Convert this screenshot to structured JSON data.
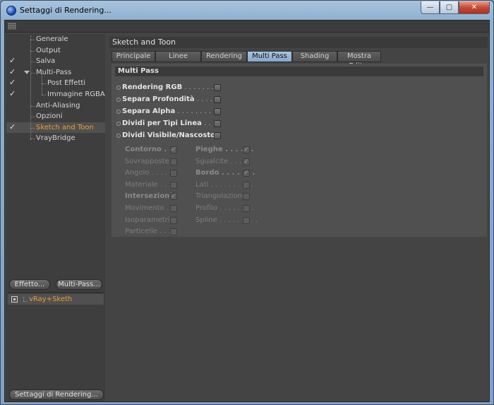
{
  "window": {
    "title": "Settaggi di Rendering..."
  },
  "caption": {
    "minimize": "—",
    "maximize": "▢",
    "close": "✕"
  },
  "tree": [
    {
      "label": "Generale",
      "checked": false
    },
    {
      "label": "Output",
      "checked": false
    },
    {
      "label": "Salva",
      "checked": true
    },
    {
      "label": "Multi-Pass",
      "checked": true
    },
    {
      "label": "Post Effetti",
      "checked": true
    },
    {
      "label": "Immagine RGBA",
      "checked": true
    },
    {
      "label": "Anti-Aliasing",
      "checked": false
    },
    {
      "label": "Opzioni",
      "checked": false
    },
    {
      "label": "Sketch and Toon",
      "checked": true
    },
    {
      "label": "VrayBridge",
      "checked": false
    }
  ],
  "check_glyph": "✓",
  "buttons": {
    "effetto": "Effetto...",
    "multipass": "Multi-Pass...",
    "settaggi": "Settaggi di Rendering..."
  },
  "effects": [
    {
      "label": "vRay+Sketh"
    }
  ],
  "panel": {
    "title": "Sketch and Toon",
    "tabs": [
      "Principale",
      "Linee",
      "Rendering",
      "Multi Pass",
      "Shading",
      "Mostra Editor"
    ],
    "active_tab": "Multi Pass",
    "section": "Multi Pass",
    "options": [
      {
        "label": "Rendering RGB",
        "leader": " . . . . . . . ."
      },
      {
        "label": "Separa Profondità",
        "leader": " . . . . . ."
      },
      {
        "label": "Separa Alpha",
        "leader": " . . . . . . . . . ."
      },
      {
        "label": "Dividi per Tipi Linea",
        "leader": " . . . ."
      },
      {
        "label": "Dividi Visibile/Nascosto",
        "leader": ""
      }
    ],
    "left_col": [
      {
        "label": "Contorno",
        "leader": " . . ",
        "bold": true,
        "checked": true
      },
      {
        "label": "Sovrapposte",
        "leader": " ",
        "bold": false,
        "checked": false
      },
      {
        "label": "Angolo",
        "leader": " . . . . . ",
        "bold": false,
        "checked": false
      },
      {
        "label": "Materiale",
        "leader": " . . . . ",
        "bold": false,
        "checked": false
      },
      {
        "label": "Intersezioni",
        "leader": " ",
        "bold": true,
        "checked": true
      },
      {
        "label": "Movimento",
        "leader": " . . ",
        "bold": false,
        "checked": false
      },
      {
        "label": "Isoparametri",
        "leader": " ",
        "bold": false,
        "checked": false
      },
      {
        "label": "Particelle",
        "leader": " . . . ",
        "bold": false,
        "checked": false
      }
    ],
    "right_col": [
      {
        "label": "Pieghe",
        "leader": " . . . . . .",
        "bold": true,
        "checked": true
      },
      {
        "label": "Sgualcite",
        "leader": " . . . . ",
        "bold": false,
        "checked": true
      },
      {
        "label": "Bordo",
        "leader": " . . . . . . .",
        "bold": true,
        "checked": true
      },
      {
        "label": "Lati",
        "leader": " . . . . . . . . . .",
        "bold": false,
        "checked": false
      },
      {
        "label": "Triangolazione",
        "leader": "",
        "bold": false,
        "checked": false
      },
      {
        "label": "Profilo",
        "leader": " . . . . . . . .",
        "bold": false,
        "checked": false
      },
      {
        "label": "Spline",
        "leader": " . . . . . . . . .",
        "bold": false,
        "checked": false
      }
    ]
  }
}
